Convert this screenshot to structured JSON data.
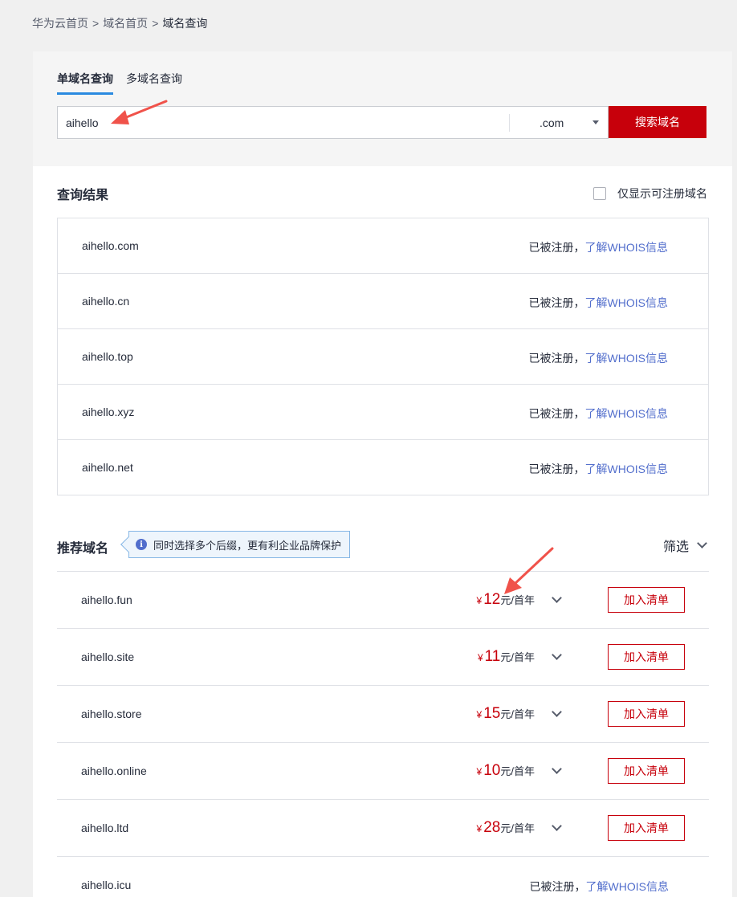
{
  "breadcrumb": {
    "items": [
      "华为云首页",
      "域名首页",
      "域名查询"
    ],
    "separator": ">"
  },
  "search": {
    "tabs": [
      {
        "label": "单域名查询",
        "active": true
      },
      {
        "label": "多域名查询",
        "active": false
      }
    ],
    "query_value": "aihello",
    "suffix_selected": ".com",
    "button_label": "搜索域名"
  },
  "results": {
    "title": "查询结果",
    "filter_label": "仅显示可注册域名",
    "rows": [
      {
        "domain": "aihello.com",
        "status": "已被注册，",
        "link": "了解WHOIS信息"
      },
      {
        "domain": "aihello.cn",
        "status": "已被注册，",
        "link": "了解WHOIS信息"
      },
      {
        "domain": "aihello.top",
        "status": "已被注册，",
        "link": "了解WHOIS信息"
      },
      {
        "domain": "aihello.xyz",
        "status": "已被注册，",
        "link": "了解WHOIS信息"
      },
      {
        "domain": "aihello.net",
        "status": "已被注册，",
        "link": "了解WHOIS信息"
      }
    ]
  },
  "recommended": {
    "title": "推荐域名",
    "tip": "同时选择多个后缀，更有利企业品牌保护",
    "filter_label": "筛选",
    "currency": "¥",
    "unit": "元/首年",
    "add_label": "加入清单",
    "rows": [
      {
        "domain": "aihello.fun",
        "price": "12"
      },
      {
        "domain": "aihello.site",
        "price": "11"
      },
      {
        "domain": "aihello.store",
        "price": "15"
      },
      {
        "domain": "aihello.online",
        "price": "10"
      },
      {
        "domain": "aihello.ltd",
        "price": "28"
      }
    ],
    "registered_row": {
      "domain": "aihello.icu",
      "status": "已被注册，",
      "link": "了解WHOIS信息"
    }
  },
  "colors": {
    "brand_red": "#c7000b",
    "link_blue": "#526ecc",
    "tab_active": "#2a8ae0",
    "annotation_arrow": "#f0524a"
  }
}
